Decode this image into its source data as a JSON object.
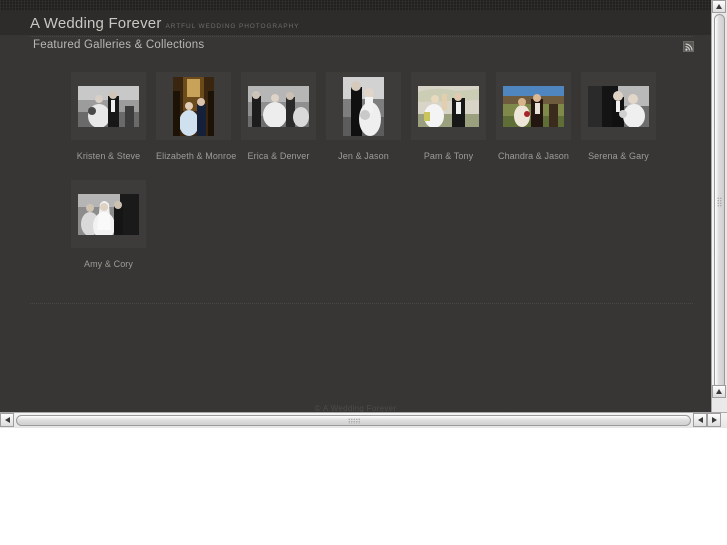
{
  "site": {
    "title": "A Wedding Forever",
    "tagline": "ARTFUL WEDDING PHOTOGRAPHY",
    "footer": "© A Wedding Forever"
  },
  "section": {
    "title": "Featured Galleries & Collections",
    "feed_icon": "rss-feed-icon"
  },
  "galleries": {
    "row1": [
      {
        "label": "Kristen & Steve",
        "orientation": "landscape",
        "tone": "bw",
        "sky": "#cfcfcf",
        "mid": "#8a8a8a",
        "dark": "#1a1a1a"
      },
      {
        "label": "Elizabeth & Monroe",
        "orientation": "portrait",
        "tone": "color",
        "sky": "#6b4a1c",
        "mid": "#c9a25a",
        "dark": "#2b1d0c"
      },
      {
        "label": "Erica & Denver",
        "orientation": "landscape",
        "tone": "bw",
        "sky": "#b9b9b9",
        "mid": "#7d7d7d",
        "dark": "#242424"
      },
      {
        "label": "Jen & Jason",
        "orientation": "portrait",
        "tone": "bw",
        "sky": "#d2d2d2",
        "mid": "#6e6e6e",
        "dark": "#141414"
      },
      {
        "label": "Pam & Tony",
        "orientation": "landscape",
        "tone": "color",
        "sky": "#d8d4c8",
        "mid": "#9aa07e",
        "dark": "#1b1b1b"
      },
      {
        "label": "Chandra & Jason",
        "orientation": "landscape",
        "tone": "color",
        "sky": "#4f86c0",
        "mid": "#7f8a4a",
        "dark": "#231510"
      },
      {
        "label": "Serena & Gary",
        "orientation": "landscape",
        "tone": "bw",
        "sky": "#c4c4c4",
        "mid": "#6a6a6a",
        "dark": "#121212"
      }
    ],
    "row2": [
      {
        "label": "Amy & Cory",
        "orientation": "landscape",
        "tone": "bw",
        "sky": "#cdcdcd",
        "mid": "#7a7a7a",
        "dark": "#101010"
      }
    ]
  },
  "scrollbars": {
    "vertical": {
      "up_arrow": "▲",
      "down_arrow": "▼"
    },
    "horizontal": {
      "left_arrow": "◀",
      "right_arrow": "▶"
    }
  },
  "colors": {
    "page_background": "#373634",
    "tile_background": "#3d3c3a",
    "title_text": "#c9c7c3",
    "label_text": "#9e9c98",
    "rule": "#4a4846"
  }
}
